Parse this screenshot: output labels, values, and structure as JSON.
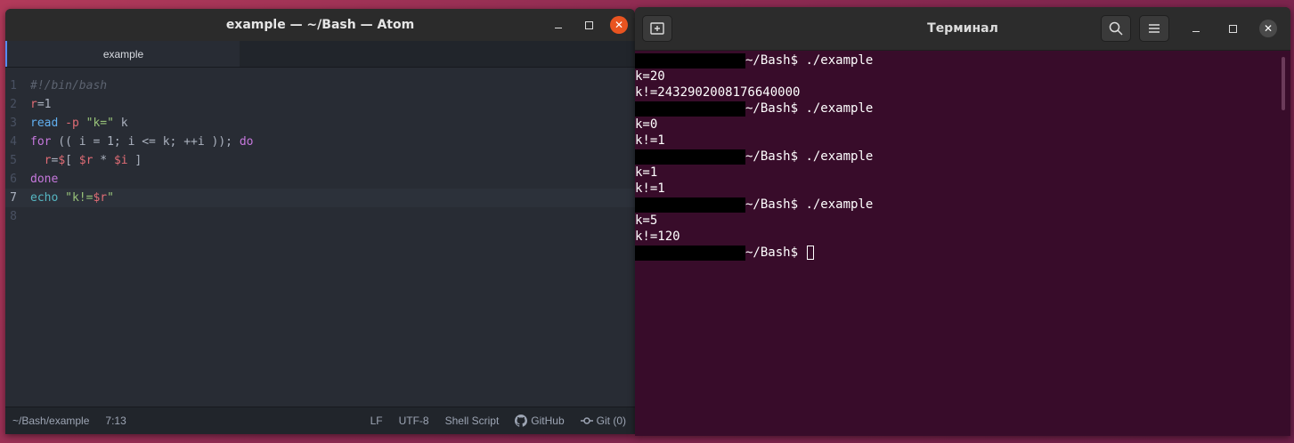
{
  "atom": {
    "title": "example — ~/Bash — Atom",
    "tab_label": "example",
    "lines": [
      {
        "n": "1"
      },
      {
        "n": "2"
      },
      {
        "n": "3"
      },
      {
        "n": "4"
      },
      {
        "n": "5"
      },
      {
        "n": "6"
      },
      {
        "n": "7"
      },
      {
        "n": "8"
      }
    ],
    "code": {
      "l1": "#!/bin/bash",
      "l2_var": "r",
      "l2_rest": "=1",
      "l3_fn": "read",
      "l3_flag": " -p ",
      "l3_str": "\"k=\"",
      "l3_rest": " k",
      "l4_kw": "for",
      "l4_rest": " (( i = 1; i <= k; ++i )); ",
      "l4_do": "do",
      "l5_indent": "  ",
      "l5_var": "r",
      "l5_eq": "=",
      "l5_dollar": "$",
      "l5_mid": "[ ",
      "l5_r": "$r",
      "l5_star": " * ",
      "l5_i": "$i",
      "l5_end": " ]",
      "l6_kw": "done",
      "l7_fn": "echo",
      "l7_str1": " \"k!=",
      "l7_var": "$r",
      "l7_str2": "\""
    },
    "status": {
      "path": "~/Bash/example",
      "position": "7:13",
      "line_ending": "LF",
      "encoding": "UTF-8",
      "grammar": "Shell Script",
      "github": "GitHub",
      "git": "Git (0)"
    }
  },
  "terminal": {
    "title": "Терминал",
    "prompt": "~/Bash$ ",
    "lines": [
      {
        "type": "prompt",
        "cmd": "./example"
      },
      {
        "type": "out",
        "text": "k=20"
      },
      {
        "type": "out",
        "text": "k!=2432902008176640000"
      },
      {
        "type": "prompt",
        "cmd": "./example"
      },
      {
        "type": "out",
        "text": "k=0"
      },
      {
        "type": "out",
        "text": "k!=1"
      },
      {
        "type": "prompt",
        "cmd": "./example"
      },
      {
        "type": "out",
        "text": "k=1"
      },
      {
        "type": "out",
        "text": "k!=1"
      },
      {
        "type": "prompt",
        "cmd": "./example"
      },
      {
        "type": "out",
        "text": "k=5"
      },
      {
        "type": "out",
        "text": "k!=120"
      },
      {
        "type": "prompt",
        "cmd": ""
      }
    ]
  },
  "colors": {
    "accent": "#e95420",
    "terminal_bg": "#380c2a",
    "editor_bg": "#282c34"
  }
}
